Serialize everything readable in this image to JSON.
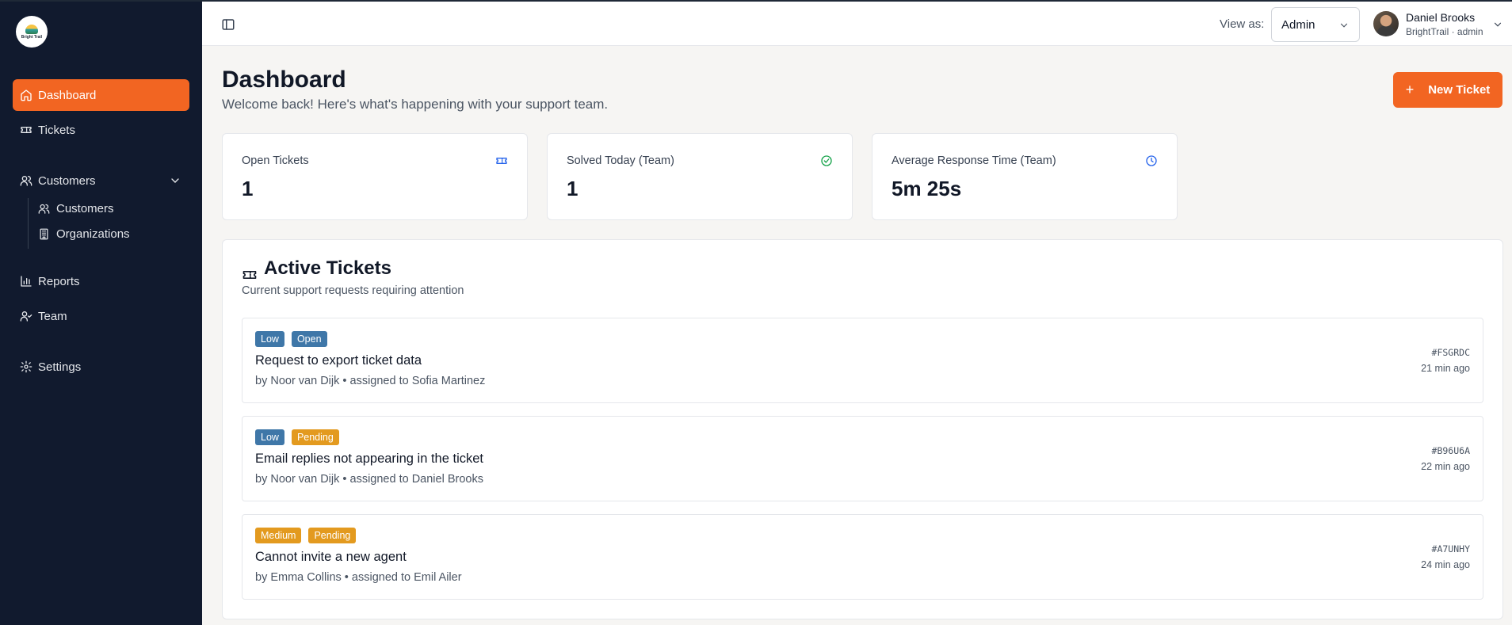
{
  "brand": {
    "logo_text": "Bright Trail"
  },
  "sidebar": {
    "items": [
      {
        "label": "Dashboard",
        "icon": "home-icon",
        "active": true
      },
      {
        "label": "Tickets",
        "icon": "ticket-icon"
      },
      {
        "label": "Customers",
        "icon": "users-icon",
        "expanded": true,
        "children": [
          {
            "label": "Customers",
            "icon": "users-icon"
          },
          {
            "label": "Organizations",
            "icon": "building-icon"
          }
        ]
      },
      {
        "label": "Reports",
        "icon": "bar-chart-icon"
      },
      {
        "label": "Team",
        "icon": "user-check-icon"
      },
      {
        "label": "Settings",
        "icon": "gear-icon"
      }
    ]
  },
  "topbar": {
    "view_as_label": "View as:",
    "view_as_value": "Admin",
    "user_name": "Daniel Brooks",
    "user_sub": "BrightTrail · admin"
  },
  "page": {
    "title": "Dashboard",
    "subtitle": "Welcome back! Here's what's happening with your support team.",
    "new_ticket_label": "New Ticket"
  },
  "stats": [
    {
      "label": "Open Tickets",
      "value": "1",
      "icon": "ticket-icon"
    },
    {
      "label": "Solved Today (Team)",
      "value": "1",
      "icon": "check-circle-icon"
    },
    {
      "label": "Average Response Time (Team)",
      "value": "5m 25s",
      "icon": "clock-icon"
    }
  ],
  "active_tickets": {
    "title": "Active Tickets",
    "subtitle": "Current support requests requiring attention",
    "tickets": [
      {
        "priority": "Low",
        "status": "Open",
        "title": "Request to export ticket data",
        "meta": "by Noor van Dijk • assigned to Sofia Martinez",
        "id": "#FSGRDC",
        "time": "21 min ago"
      },
      {
        "priority": "Low",
        "status": "Pending",
        "title": "Email replies not appearing in the ticket",
        "meta": "by Noor van Dijk • assigned to Daniel Brooks",
        "id": "#B96U6A",
        "time": "22 min ago"
      },
      {
        "priority": "Medium",
        "status": "Pending",
        "title": "Cannot invite a new agent",
        "meta": "by Emma Collins • assigned to Emil Ailer",
        "id": "#A7UNHY",
        "time": "24 min ago"
      }
    ]
  },
  "colors": {
    "sidebar_bg": "#111a2e",
    "accent": "#f26522",
    "badge_blue": "#3f77a8",
    "badge_amber": "#e39a1f",
    "success": "#16a34a",
    "info": "#2563eb"
  }
}
